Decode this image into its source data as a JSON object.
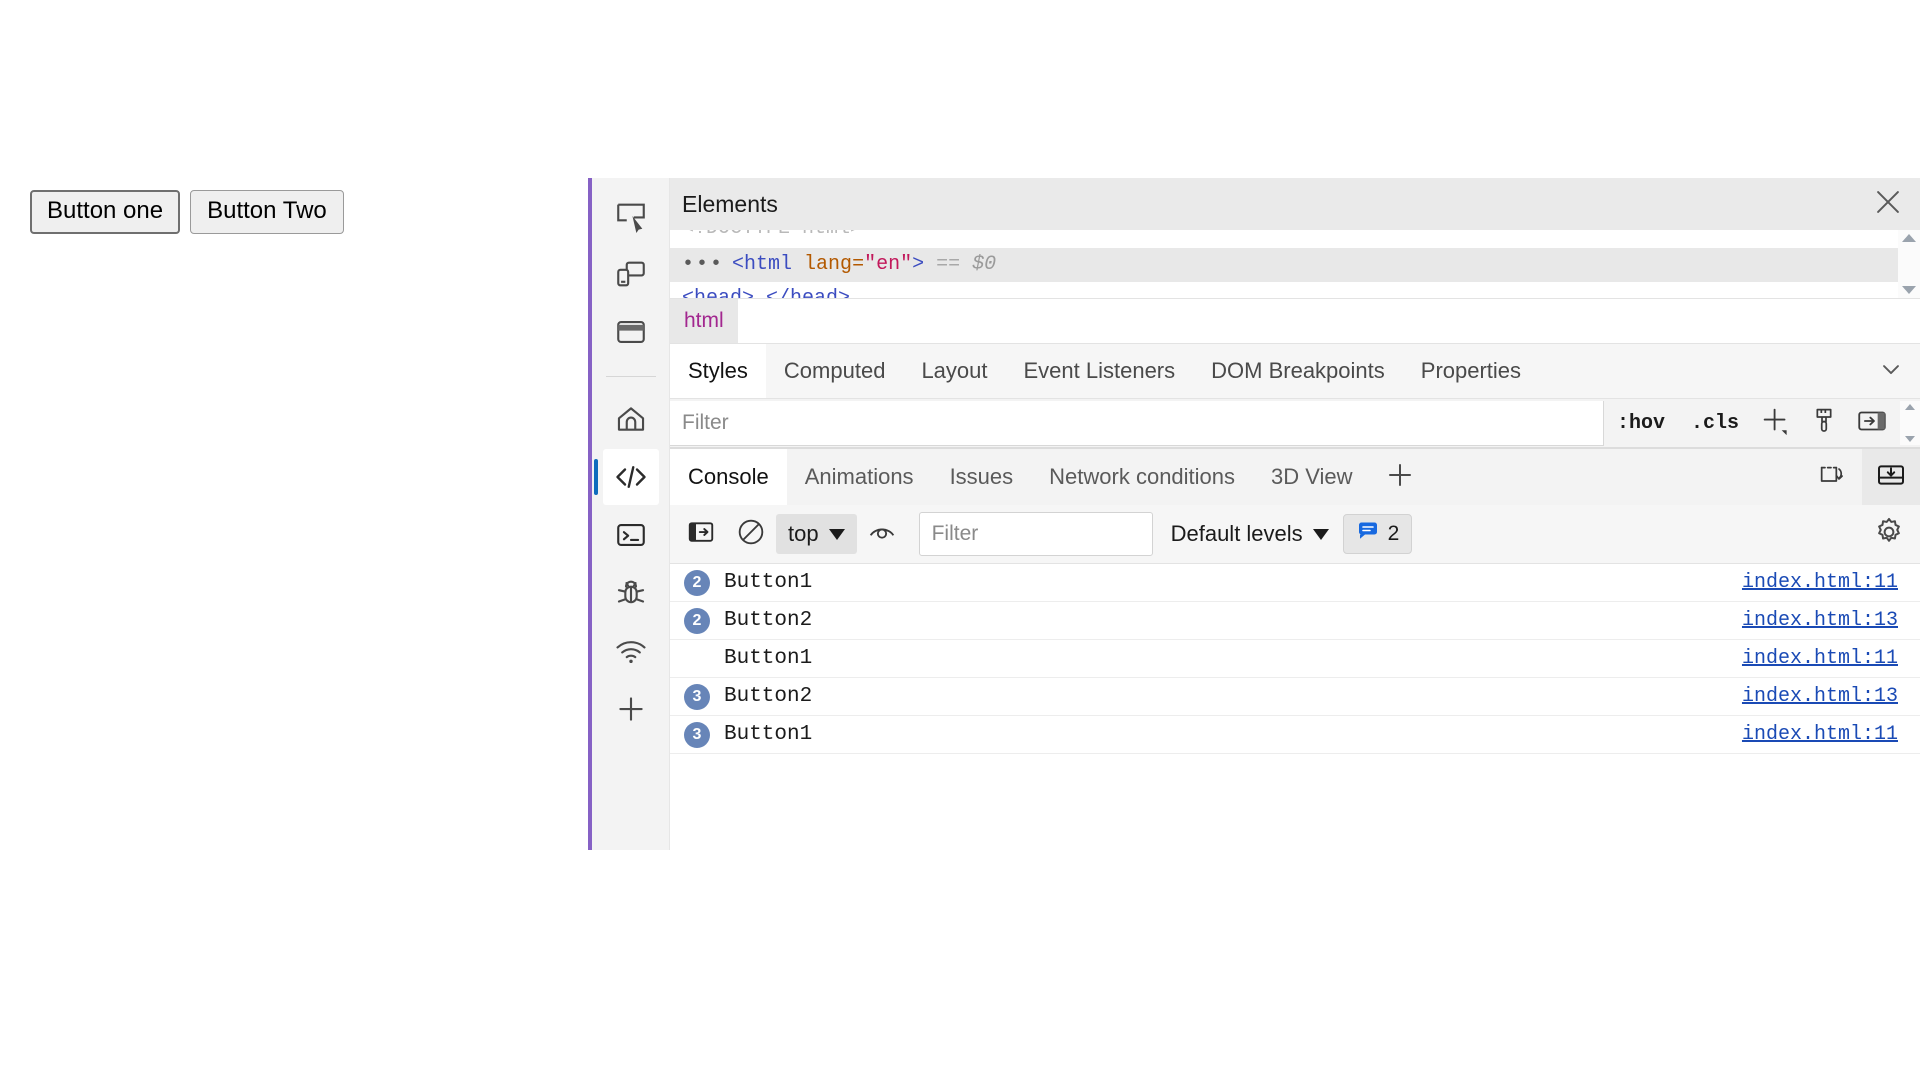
{
  "page": {
    "buttons": [
      {
        "label": "Button one",
        "focused": true
      },
      {
        "label": "Button Two",
        "focused": false
      }
    ]
  },
  "devtools": {
    "accent_color": "#8661c5",
    "selected_color": "#0f6cbd",
    "activity_bar": {
      "items": [
        {
          "icon": "inspect-element-icon",
          "selected": false
        },
        {
          "icon": "device-emulation-icon",
          "selected": false
        },
        {
          "icon": "window-dock-icon",
          "selected": false
        },
        {
          "icon": "home-icon",
          "selected": false
        },
        {
          "icon": "elements-code-icon",
          "selected": true
        },
        {
          "icon": "console-terminal-icon",
          "selected": false
        },
        {
          "icon": "debugger-bug-icon",
          "selected": false
        },
        {
          "icon": "network-wifi-icon",
          "selected": false
        },
        {
          "icon": "add-tool-icon",
          "selected": false
        }
      ]
    },
    "elements_panel": {
      "title": "Elements",
      "close_label": "Close",
      "dom_tree": {
        "line_above": "<!DOCTYPE html>",
        "selected_line": {
          "dots": "•••",
          "open": "<html",
          "attr_name": "lang",
          "attr_eq": "=",
          "attr_value": "\"en\"",
          "close": ">",
          "equals": "==",
          "dollar_ref": "$0"
        },
        "line_below": "<head>…</head>"
      },
      "breadcrumb": [
        "html"
      ],
      "styles_tabs": [
        {
          "label": "Styles",
          "active": true
        },
        {
          "label": "Computed",
          "active": false
        },
        {
          "label": "Layout",
          "active": false
        },
        {
          "label": "Event Listeners",
          "active": false
        },
        {
          "label": "DOM Breakpoints",
          "active": false
        },
        {
          "label": "Properties",
          "active": false
        }
      ],
      "styles_filter": {
        "placeholder": "Filter",
        "value": "",
        "hov_label": ":hov",
        "cls_label": ".cls",
        "new_rule_icon": "plus-new-style-rule-icon",
        "copy_icon": "paintbrush-icon",
        "toggle_icon": "toggle-sidebar-icon"
      }
    },
    "drawer": {
      "tabs": [
        {
          "label": "Console",
          "active": true
        },
        {
          "label": "Animations",
          "active": false
        },
        {
          "label": "Issues",
          "active": false
        },
        {
          "label": "Network conditions",
          "active": false
        },
        {
          "label": "3D View",
          "active": false
        }
      ],
      "add_tab_icon": "plus-icon",
      "right_icons": [
        {
          "icon": "move-panel-icon"
        },
        {
          "icon": "dock-to-bottom-icon"
        }
      ],
      "console_toolbar": {
        "sidebar_icon": "console-sidebar-icon",
        "clear_icon": "clear-console-icon",
        "context": "top",
        "live_expression_icon": "eye-live-expression-icon",
        "filter_placeholder": "Filter",
        "filter_value": "",
        "levels_label": "Default levels",
        "message_count": "2",
        "message_badge_icon": "message-bubble-icon",
        "settings_icon": "gear-icon"
      },
      "console_messages": [
        {
          "count": "2",
          "text": "Button1",
          "source": "index.html:11"
        },
        {
          "count": "2",
          "text": "Button2",
          "source": "index.html:13"
        },
        {
          "count": "",
          "text": "Button1",
          "source": "index.html:11"
        },
        {
          "count": "3",
          "text": "Button2",
          "source": "index.html:13"
        },
        {
          "count": "3",
          "text": "Button1",
          "source": "index.html:11"
        }
      ]
    }
  }
}
